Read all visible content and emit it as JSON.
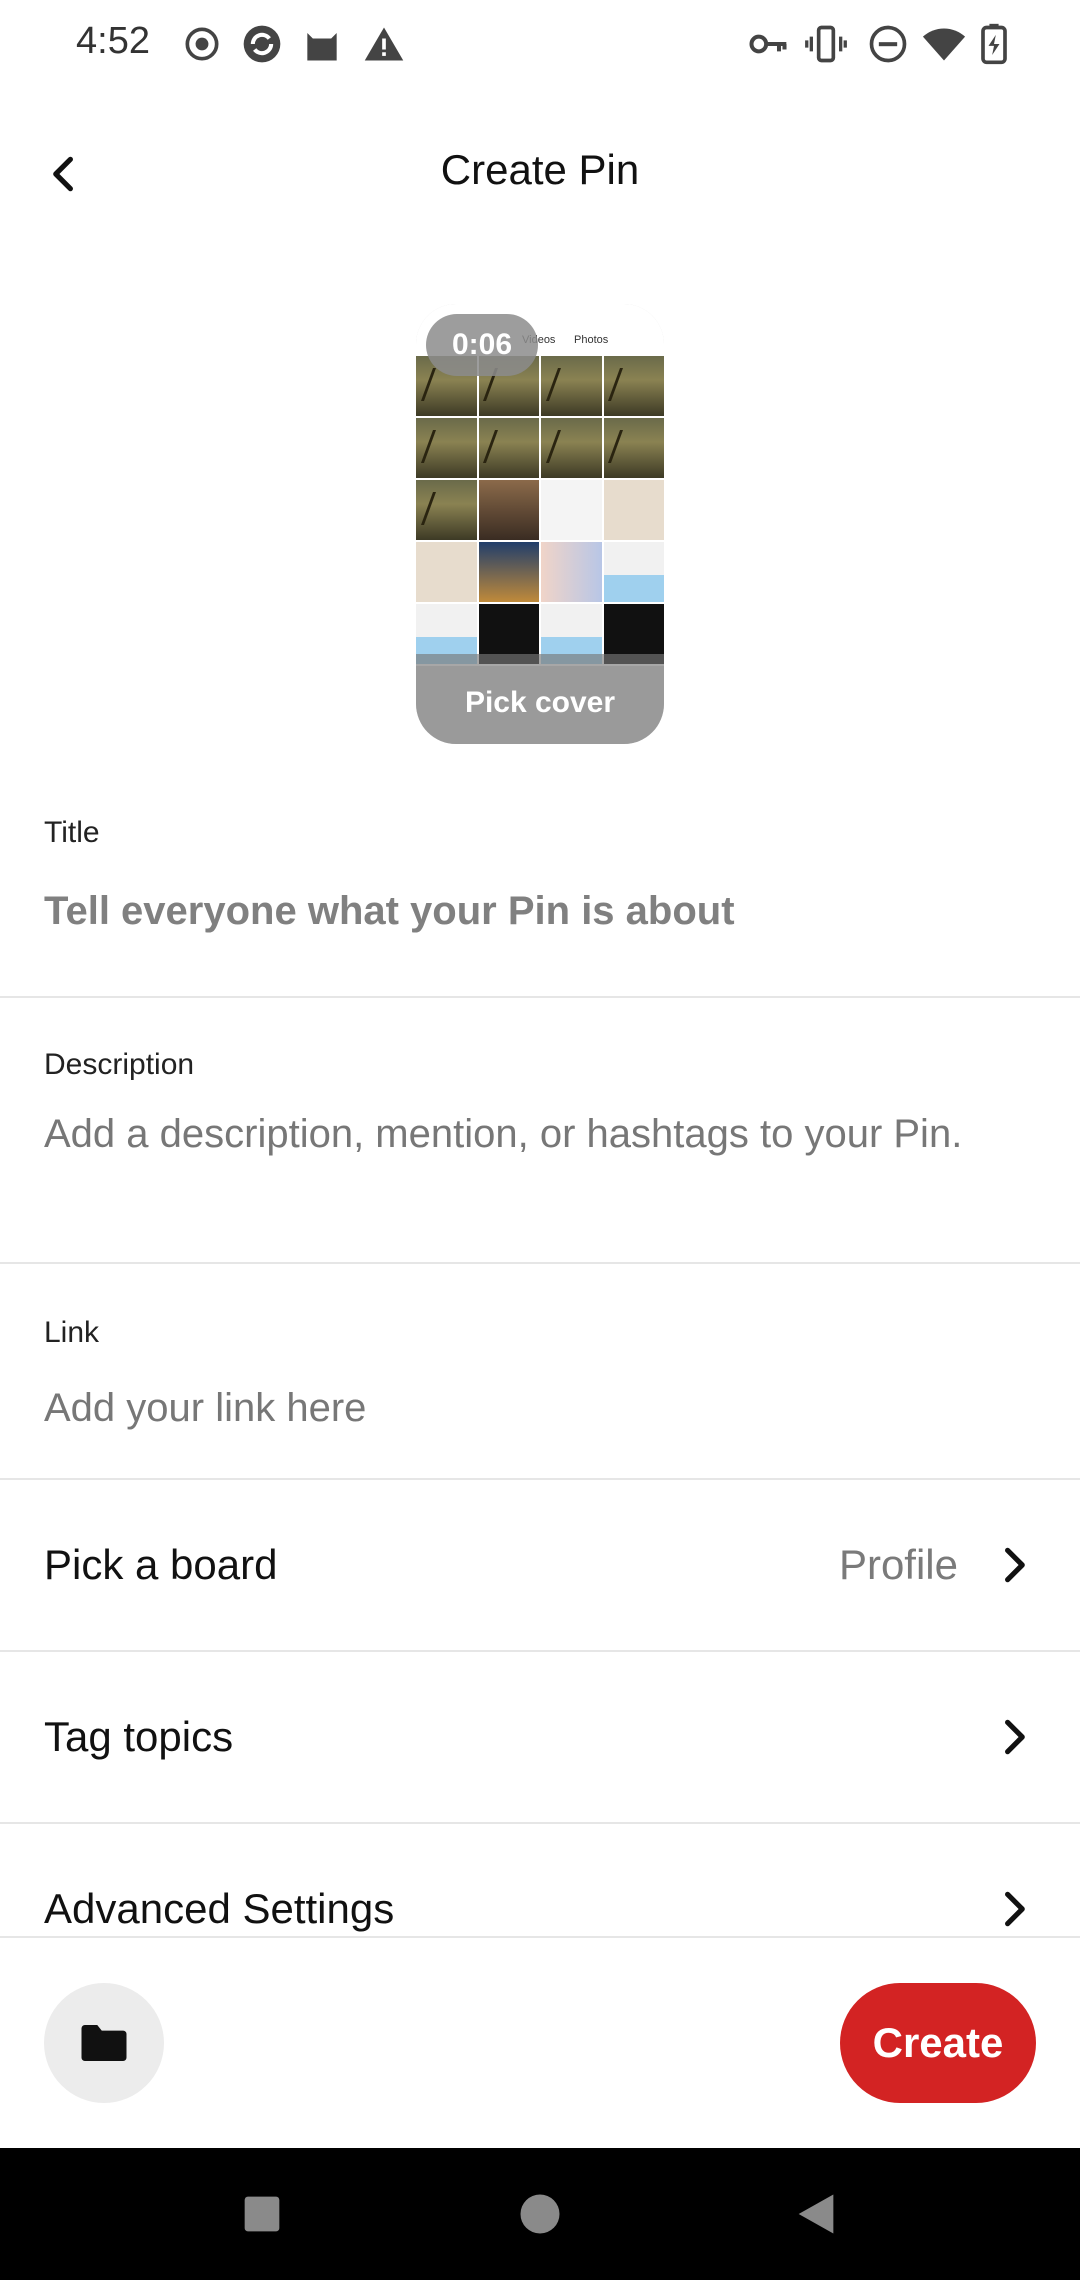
{
  "status_bar": {
    "time": "4:52",
    "left_icons": [
      "record-icon",
      "sync-icon",
      "cat-icon",
      "warning-icon"
    ],
    "right_icons": [
      "key-icon",
      "vibrate-icon",
      "dnd-icon",
      "wifi-icon",
      "battery-charging-icon"
    ]
  },
  "header": {
    "title": "Create Pin",
    "back_icon": "chevron-left-icon"
  },
  "cover": {
    "duration": "0:06",
    "tabs": [
      "Videos",
      "Photos"
    ],
    "pick_cover_label": "Pick cover"
  },
  "form": {
    "title": {
      "label": "Title",
      "value": "",
      "placeholder": "Tell everyone what your Pin is about"
    },
    "description": {
      "label": "Description",
      "value": "",
      "placeholder": "Add a description, mention, or hashtags to your Pin."
    },
    "link": {
      "label": "Link",
      "value": "",
      "placeholder": "Add your link here"
    }
  },
  "rows": [
    {
      "label": "Pick a board",
      "value": "Profile",
      "icon": "chevron-right-icon"
    },
    {
      "label": "Tag topics",
      "value": "",
      "icon": "chevron-right-icon"
    },
    {
      "label": "Advanced Settings",
      "value": "",
      "icon": "chevron-right-icon"
    }
  ],
  "actions": {
    "folder_icon": "folder-icon",
    "create_label": "Create",
    "create_color": "#d32323"
  },
  "nav_bar": {
    "buttons": [
      "recents-square-icon",
      "home-circle-icon",
      "back-triangle-icon"
    ]
  }
}
